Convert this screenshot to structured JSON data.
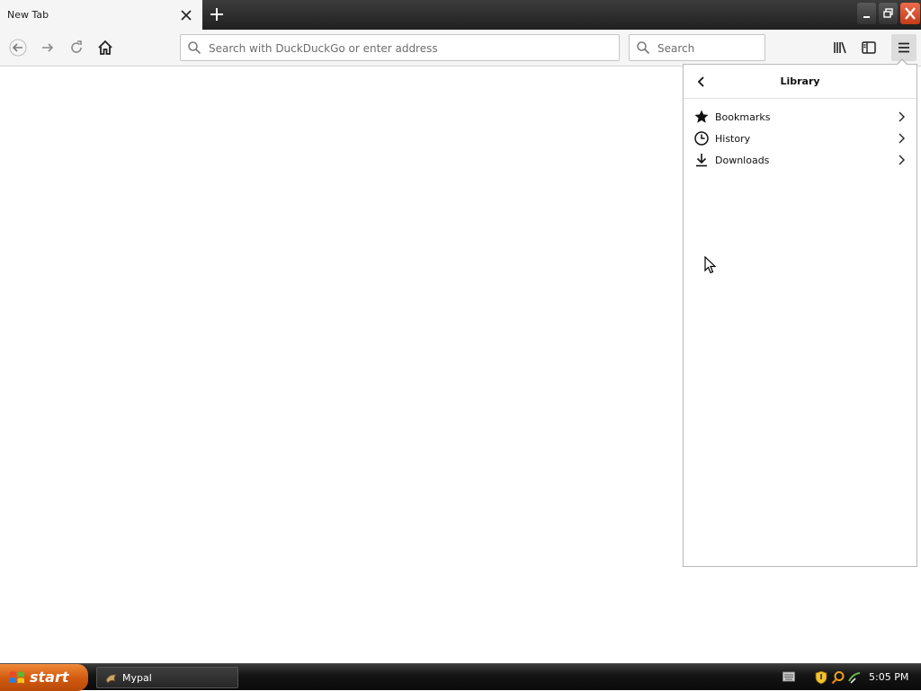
{
  "tab": {
    "title": "New Tab"
  },
  "urlbar": {
    "placeholder": "Search with DuckDuckGo or enter address"
  },
  "searchbar": {
    "placeholder": "Search"
  },
  "library_panel": {
    "title": "Library",
    "items": [
      {
        "label": "Bookmarks",
        "icon": "star-icon"
      },
      {
        "label": "History",
        "icon": "clock-icon"
      },
      {
        "label": "Downloads",
        "icon": "download-icon"
      }
    ]
  },
  "taskbar": {
    "start_label": "start",
    "tasks": [
      {
        "label": "Mypal"
      }
    ],
    "clock": "5:05 PM"
  },
  "colors": {
    "close_button": "#d94a24",
    "start_button": "#d35b10",
    "toolbar_bg": "#f5f5f5"
  }
}
